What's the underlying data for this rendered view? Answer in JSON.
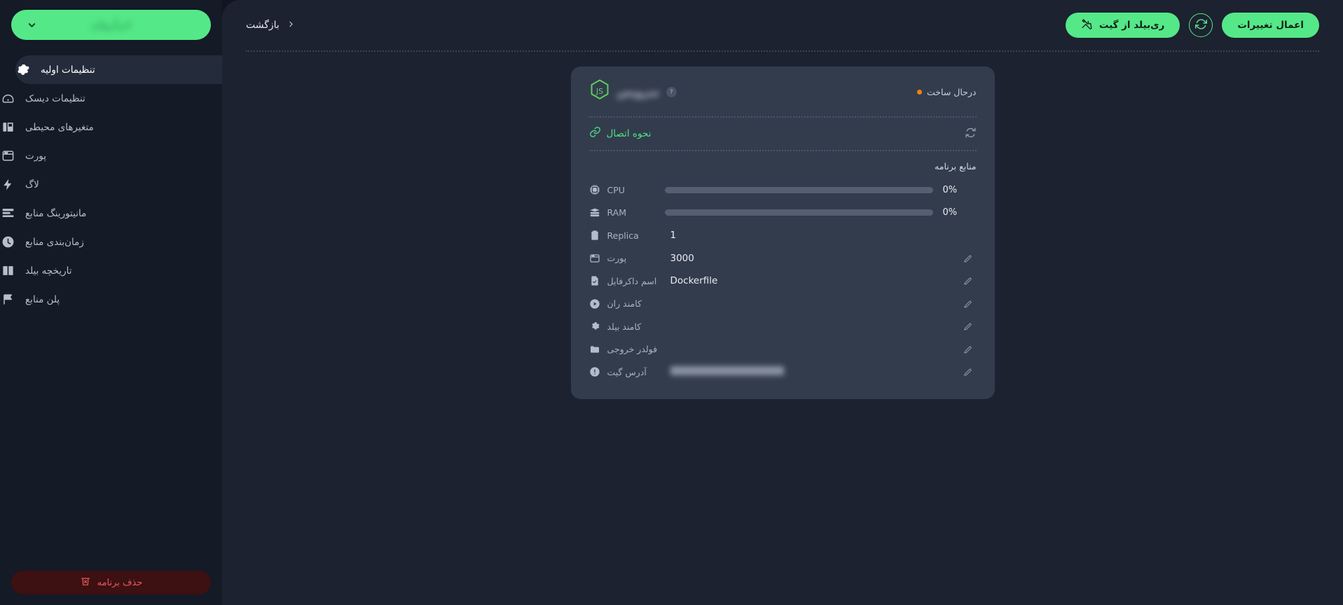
{
  "colors": {
    "page_backdrop": "#10151f",
    "main_bg": "#1c2230",
    "sidebar_bg": "#141a26",
    "card_bg": "#333c4d",
    "accent_green": "#55e888",
    "link_green": "#4fe183",
    "status_orange": "#f2820c",
    "danger_red": "#e8595e",
    "danger_bg": "#3d1012",
    "active_nav_bg": "#242b3b",
    "bar_track": "#555f72"
  },
  "sidebar": {
    "env_select": {
      "name": "environment-selector",
      "value_redacted": true,
      "chevron_icon": "chevron-down-icon"
    },
    "items": [
      {
        "label": "تنظیمات اولیه",
        "icon": "gear-icon",
        "active": true
      },
      {
        "label": "تنظیمات دیسک",
        "icon": "disk-icon",
        "active": false
      },
      {
        "label": "متغیرهای محیطی",
        "icon": "variables-icon",
        "active": false
      },
      {
        "label": "پورت",
        "icon": "window-icon",
        "active": false
      },
      {
        "label": "لاگ",
        "icon": "bolt-icon",
        "active": false
      },
      {
        "label": "مانیتورینگ منابع",
        "icon": "monitor-icon",
        "active": false
      },
      {
        "label": "زمان‌بندی منابع",
        "icon": "clock-icon",
        "active": false
      },
      {
        "label": "تاریخچه بیلد",
        "icon": "book-icon",
        "active": false
      },
      {
        "label": "پلن منابع",
        "icon": "flag-icon",
        "active": false
      }
    ],
    "delete_button": {
      "label": "حذف برنامه",
      "icon": "trash-x-icon"
    }
  },
  "toolbar": {
    "back_label": "بازگشت",
    "back_icon": "chevron-right-icon",
    "apply_label": "اعمال تغییرات",
    "rebuild_label": "ری‌بیلد از گیت",
    "rebuild_icon": "tools-icon",
    "refresh_icon": "refresh-icon"
  },
  "card": {
    "runtime_icon": "nodejs-js-icon",
    "app_name_redacted": true,
    "help_icon": "question-mark-icon",
    "status": {
      "label": "درحال ساخت",
      "dot_color": "#f2820c"
    },
    "connection": {
      "label": "نحوه اتصال",
      "icon": "link-icon",
      "refresh_icon": "refresh-icon"
    },
    "resources_title": "منابع برنامه",
    "metrics": [
      {
        "label": "CPU",
        "icon": "cpu-chip-icon",
        "value": "0%",
        "percent": 0
      },
      {
        "label": "RAM",
        "icon": "server-ram-icon",
        "value": "0%",
        "percent": 0
      }
    ],
    "fields": [
      {
        "label": "Replica",
        "icon": "clipboard-icon",
        "value": "1",
        "editable": false,
        "redacted": false
      },
      {
        "label": "پورت",
        "icon": "window-icon",
        "value": "3000",
        "editable": true,
        "redacted": false
      },
      {
        "label": "اسم داکرفایل",
        "icon": "file-check-icon",
        "value": "Dockerfile",
        "editable": true,
        "redacted": false
      },
      {
        "label": "کامند ران",
        "icon": "play-circle-icon",
        "value": "",
        "editable": true,
        "redacted": false
      },
      {
        "label": "کامند بیلد",
        "icon": "gear-icon",
        "value": "",
        "editable": true,
        "redacted": false
      },
      {
        "label": "فولدر خروجی",
        "icon": "folder-icon",
        "value": "",
        "editable": true,
        "redacted": false
      },
      {
        "label": "آدرس گیت",
        "icon": "info-circle-icon",
        "value": "",
        "editable": true,
        "redacted": true
      }
    ]
  }
}
